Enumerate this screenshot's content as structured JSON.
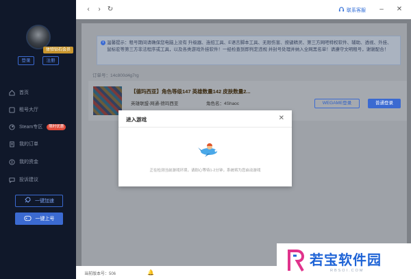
{
  "sidebar": {
    "vip_badge": "体验钻石会员",
    "login": "登录",
    "register": "注册",
    "nav": [
      {
        "label": "首页",
        "icon": "home-icon"
      },
      {
        "label": "租号大厅",
        "icon": "hall-icon"
      },
      {
        "label": "Steam专区",
        "icon": "steam-icon",
        "badge": "限时优惠"
      },
      {
        "label": "我的订单",
        "icon": "order-icon"
      },
      {
        "label": "我的资金",
        "icon": "wallet-icon"
      },
      {
        "label": "投诉建议",
        "icon": "feedback-icon"
      }
    ],
    "accelerate": "一键加速",
    "quick_login": "一键上号"
  },
  "titlebar": {
    "support": "联系客服"
  },
  "notice": {
    "text": "温馨提示：租号期间请确保您电脑上没有 升级器、连招工具、E语言脚本工具、无限伤害、按键精灵、第三方网吧特权软件、辅助、透视、外挂、鼠标宏等第三方非法程序或工具，以及各类游戏外挂软件！一经检查到即判定违规 并封号处理并纳入全网黑名单！请遵守文明租号，谢谢配合！"
  },
  "order": {
    "label": "订单号：14c800d4g7rg"
  },
  "card": {
    "title": "【德玛西亚】角色等级147 英雄数量142 皮肤数量2...",
    "sub": "英雄联盟-网通-德玛西亚",
    "role": "角色名：4Shaoc",
    "wegame": "WEGAME登录",
    "normal": "普通登录"
  },
  "statusbar": {
    "version": "当前版本号：506"
  },
  "modal": {
    "title": "进入游戏",
    "message": "正在检测当前游戏环境，请耐心等待1-2分钟，系统将为您启动游戏"
  },
  "watermark": {
    "text": "若宝软件园",
    "url": "RBSOI.COM"
  },
  "colors": {
    "accent": "#3b6ad1",
    "sidebar": "#10182a"
  }
}
